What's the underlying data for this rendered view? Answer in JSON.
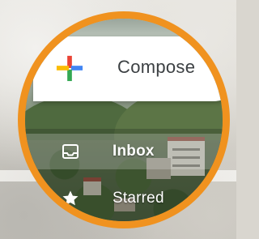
{
  "compose": {
    "label": "Compose",
    "icon": "plus-multicolor-icon",
    "icon_colors": [
      "#ea4335",
      "#4285f4",
      "#34a853",
      "#fbbc04"
    ]
  },
  "nav": {
    "items": [
      {
        "label": "Inbox",
        "icon": "inbox-icon",
        "selected": true
      },
      {
        "label": "Starred",
        "icon": "star-icon",
        "selected": false
      }
    ]
  },
  "theme": {
    "lens_border": "#f0921f",
    "nav_text": "#ffffff"
  }
}
